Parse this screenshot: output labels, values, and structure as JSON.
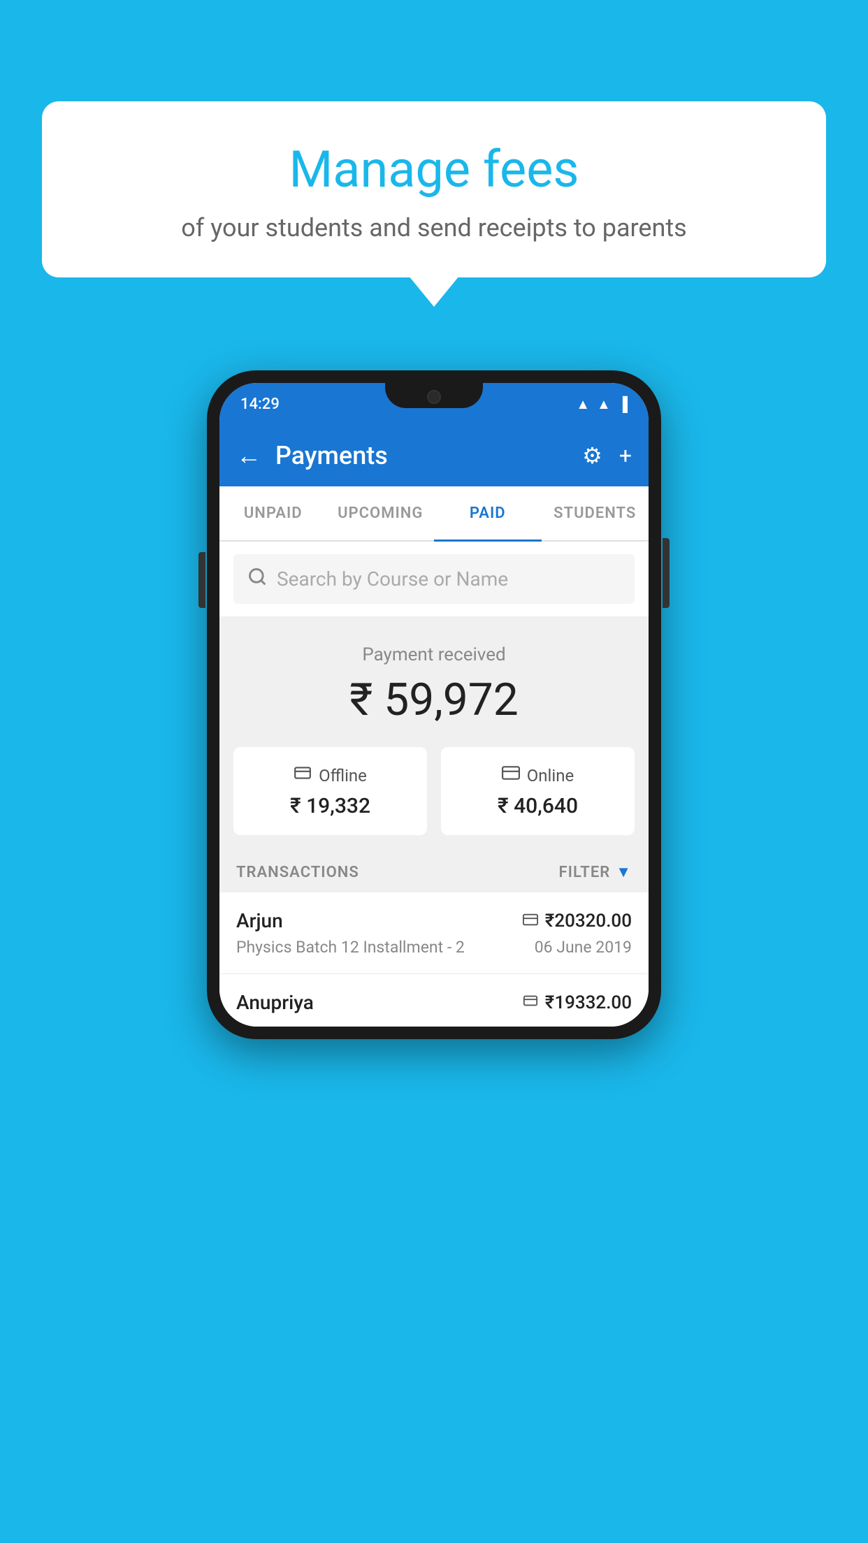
{
  "background_color": "#1ab7ea",
  "speech_bubble": {
    "title": "Manage fees",
    "subtitle": "of your students and send receipts to parents"
  },
  "phone": {
    "status_bar": {
      "time": "14:29",
      "icons": [
        "wifi",
        "signal",
        "battery"
      ]
    },
    "app_bar": {
      "back_label": "←",
      "title": "Payments",
      "gear_icon": "⚙",
      "plus_icon": "+"
    },
    "tabs": [
      {
        "label": "UNPAID",
        "active": false
      },
      {
        "label": "UPCOMING",
        "active": false
      },
      {
        "label": "PAID",
        "active": true
      },
      {
        "label": "STUDENTS",
        "active": false
      }
    ],
    "search": {
      "placeholder": "Search by Course or Name"
    },
    "payment_received": {
      "label": "Payment received",
      "amount": "₹ 59,972",
      "offline": {
        "icon": "₹",
        "label": "Offline",
        "amount": "₹ 19,332"
      },
      "online": {
        "icon": "💳",
        "label": "Online",
        "amount": "₹ 40,640"
      }
    },
    "transactions": {
      "header_label": "TRANSACTIONS",
      "filter_label": "FILTER",
      "items": [
        {
          "name": "Arjun",
          "payment_type_icon": "💳",
          "amount": "₹20320.00",
          "course": "Physics Batch 12 Installment - 2",
          "date": "06 June 2019"
        },
        {
          "name": "Anupriya",
          "payment_type_icon": "₹",
          "amount": "₹19332.00",
          "course": "",
          "date": ""
        }
      ]
    }
  }
}
